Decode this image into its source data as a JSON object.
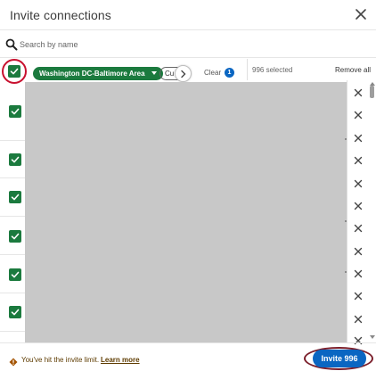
{
  "header": {
    "title": "Invite connections"
  },
  "search": {
    "placeholder": "Search by name",
    "value": ""
  },
  "filters": {
    "location_pill": "Washington DC-Baltimore Area",
    "current_pill": "Cu",
    "clear_label": "Clear",
    "clear_count": "1"
  },
  "selection": {
    "count_label": "996 selected",
    "remove_all_label": "Remove all"
  },
  "footer": {
    "warning_text": "You've hit the invite limit.",
    "learn_more_label": "Learn more",
    "invite_button_label": "Invite 996"
  },
  "colors": {
    "accent_green": "#1b7a3e",
    "primary_blue": "#0a66c2",
    "annotation_red": "#c8102e",
    "annotation_maroon": "#7b1f2b",
    "redaction_gray": "#c8c8c8"
  },
  "icons": [
    "close-icon",
    "search-icon",
    "checkmark-icon",
    "chevron-right-icon",
    "caret-down-icon",
    "remove-x-icon",
    "warning-icon"
  ]
}
